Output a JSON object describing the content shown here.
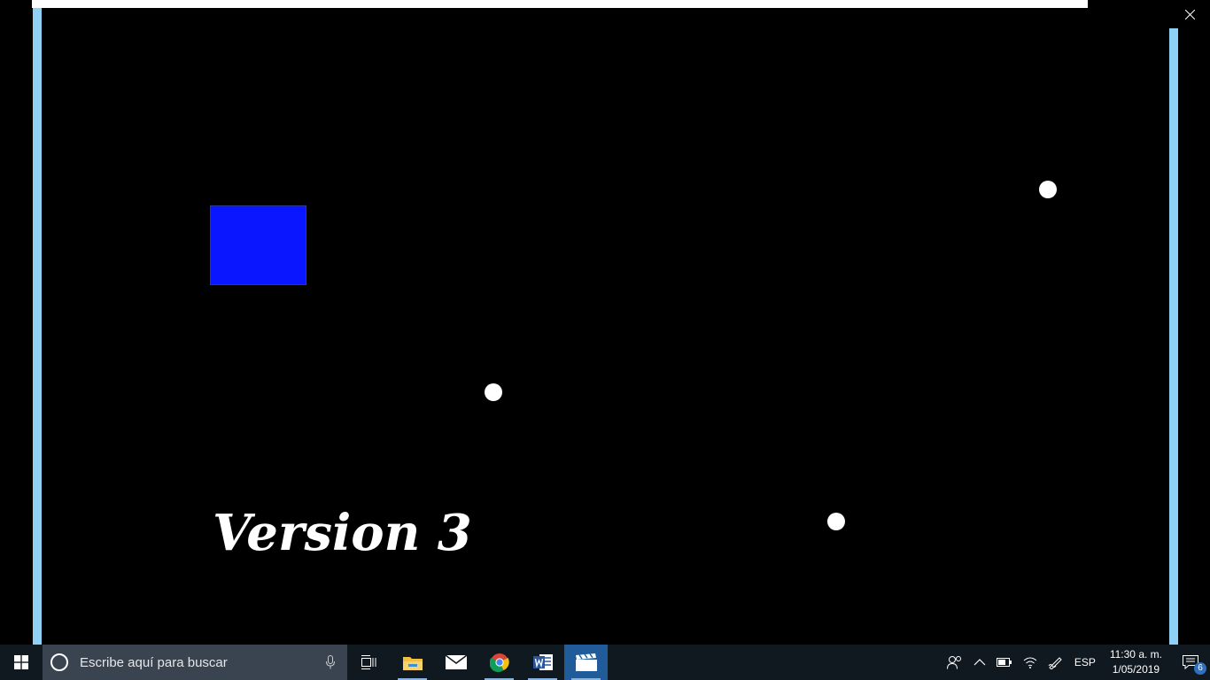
{
  "game": {
    "title_text": "Version 3",
    "colors": {
      "background": "#000000",
      "player": "#0a16ff",
      "ball": "#ffffff",
      "wall": "#8fd1f5"
    }
  },
  "window_controls": {
    "minimize_icon": "minimize-icon",
    "restore_icon": "restore-icon",
    "close_icon": "close-icon"
  },
  "taskbar": {
    "search_placeholder": "Escribe aquí para buscar",
    "pinned": [
      "task-view-icon",
      "file-explorer-icon",
      "mail-icon",
      "chrome-icon",
      "word-icon",
      "video-editor-icon"
    ],
    "language": "ESP",
    "time": "11:30 a. m.",
    "date": "1/05/2019",
    "notification_count": "6"
  }
}
